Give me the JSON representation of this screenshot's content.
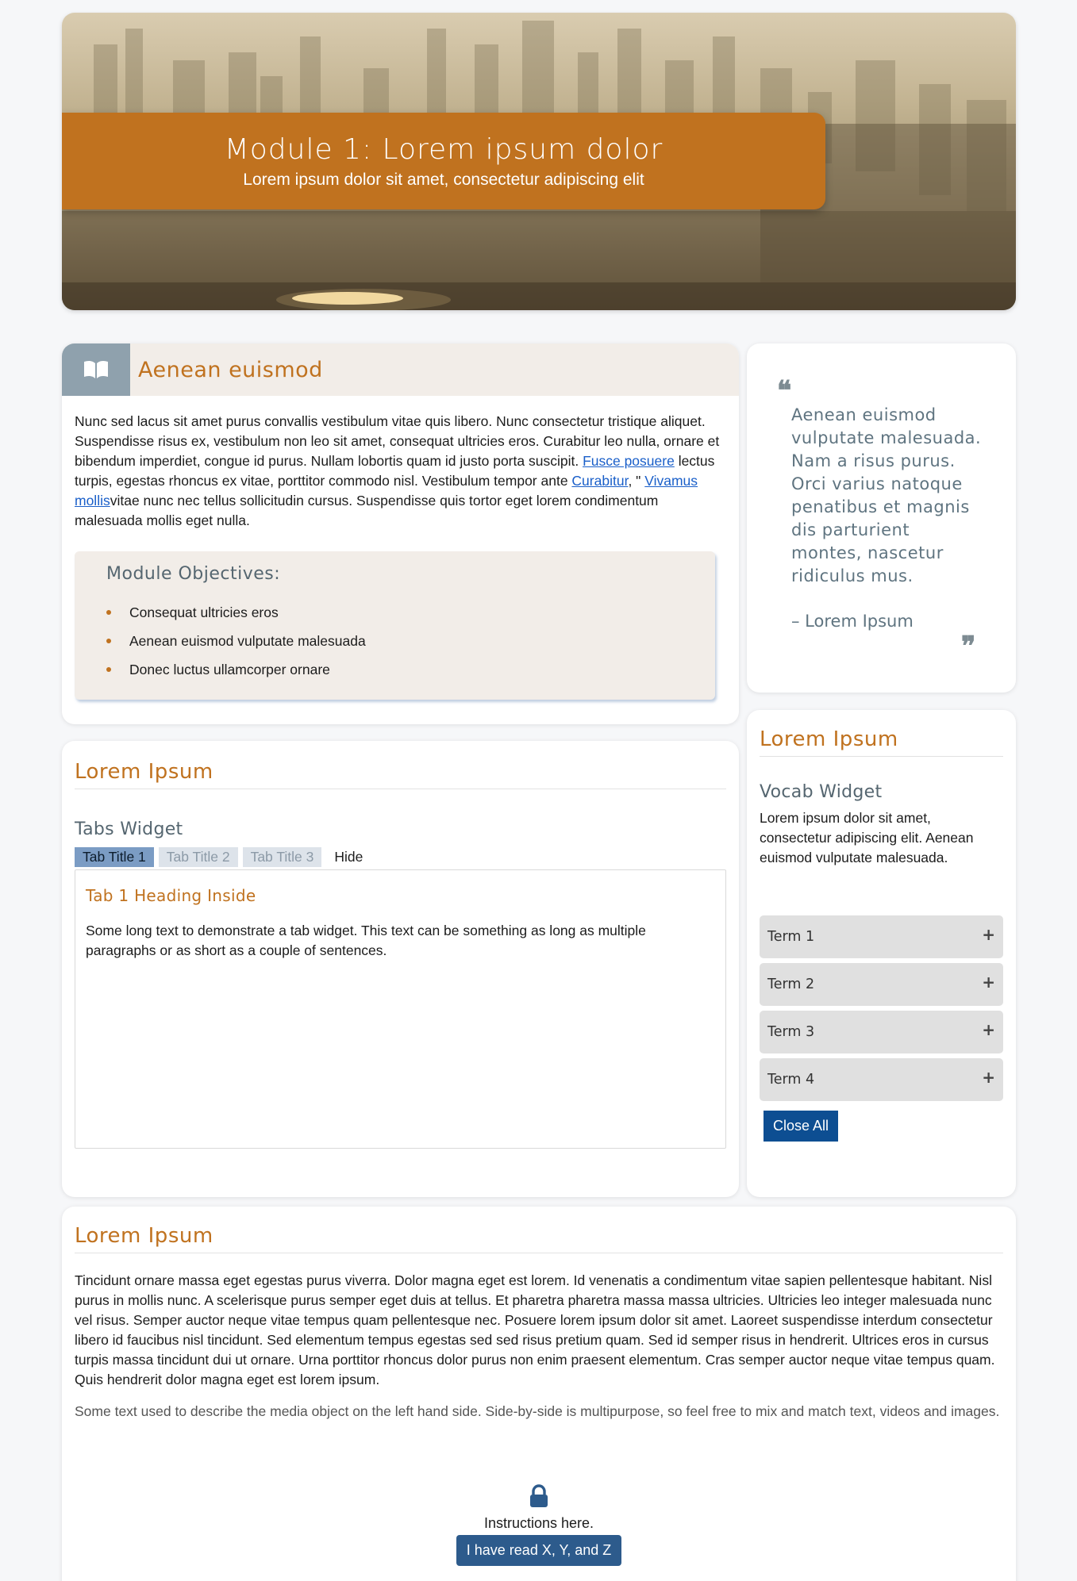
{
  "hero": {
    "title": "Module 1: Lorem ipsum dolor",
    "subtitle": "Lorem ipsum dolor sit amet, consectetur adipiscing elit"
  },
  "intro": {
    "icon": "book-icon",
    "title": "Aenean euismod",
    "p_before_link1": "Nunc sed lacus sit amet purus convallis vestibulum vitae quis libero. Nunc consectetur tristique aliquet. Suspendisse risus ex, vestibulum non leo sit amet, consequat ultricies eros. Curabitur leo nulla, ornare et bibendum imperdiet, congue id purus. Nullam lobortis quam id justo porta suscipit. ",
    "link1": "Fusce posuere",
    "p_after_link1": " lectus turpis, egestas rhoncus ex vitae, porttitor commodo nisl. Vestibulum tempor ante ",
    "link2": "Curabitur",
    "p_between": ", \" ",
    "link3": "Vivamus mollis",
    "p_end": "vitae nunc nec tellus sollicitudin cursus. Suspendisse quis tortor eget lorem condimentum malesuada mollis eget nulla.",
    "objectives_title": "Module Objectives:",
    "objectives": [
      "Consequat ultricies eros",
      "Aenean euismod vulputate malesuada",
      "Donec luctus ullamcorper ornare"
    ]
  },
  "quote": {
    "open_mark": "❝",
    "text": "Aenean euismod vulputate malesuada. Nam a risus purus. Orci varius natoque penatibus et magnis dis parturient montes, nascetur ridiculus mus.",
    "author": "– Lorem Ipsum",
    "close_mark": "❞"
  },
  "tabs_section": {
    "title": "Lorem Ipsum",
    "widget_title": "Tabs Widget",
    "tabs": [
      "Tab Title 1",
      "Tab Title 2",
      "Tab Title 3"
    ],
    "hide_label": "Hide",
    "panel_heading": "Tab 1 Heading Inside",
    "panel_text": "Some long text to demonstrate a tab widget. This text can be something as long as multiple paragraphs or as short as a couple of sentences."
  },
  "vocab_section": {
    "title": "Lorem Ipsum",
    "widget_title": "Vocab Widget",
    "description": "Lorem ipsum dolor sit amet, consectetur adipiscing elit. Aenean euismod vulputate malesuada.",
    "terms": [
      "Term 1",
      "Term 2",
      "Term 3",
      "Term 4"
    ],
    "expand_symbol": "+",
    "close_all_label": "Close All"
  },
  "bottom_section": {
    "title": "Lorem Ipsum",
    "paragraph": "Tincidunt ornare massa eget egestas purus viverra. Dolor magna eget est lorem. Id venenatis a condimentum vitae sapien pellentesque habitant. Nisl purus in mollis nunc. A scelerisque purus semper eget duis at tellus. Et pharetra pharetra massa massa ultricies. Ultricies leo integer malesuada nunc vel risus. Semper auctor neque vitae tempus quam pellentesque nec. Posuere lorem ipsum dolor sit amet. Laoreet suspendisse interdum consectetur libero id faucibus nisl tincidunt. Sed elementum tempus egestas sed sed risus pretium quam. Sed id semper risus in hendrerit. Ultrices eros in cursus turpis massa tincidunt dui ut ornare. Urna porttitor rhoncus dolor purus non enim praesent elementum. Cras semper auctor neque vitae tempus quam. Quis hendrerit dolor magna eget est lorem ipsum.",
    "media_text": "Some text used to describe the media object on the left hand side. Side-by-side is multipurpose, so feel free to mix and match text, videos and images.",
    "lock_icon": "lock-icon",
    "instructions": "Instructions here.",
    "confirm_button": "I have read X, Y, and Z"
  },
  "colors": {
    "accent": "#c0721f",
    "primary_button": "#0d4e92",
    "link": "#1a5fc9",
    "muted_heading": "#556670"
  }
}
